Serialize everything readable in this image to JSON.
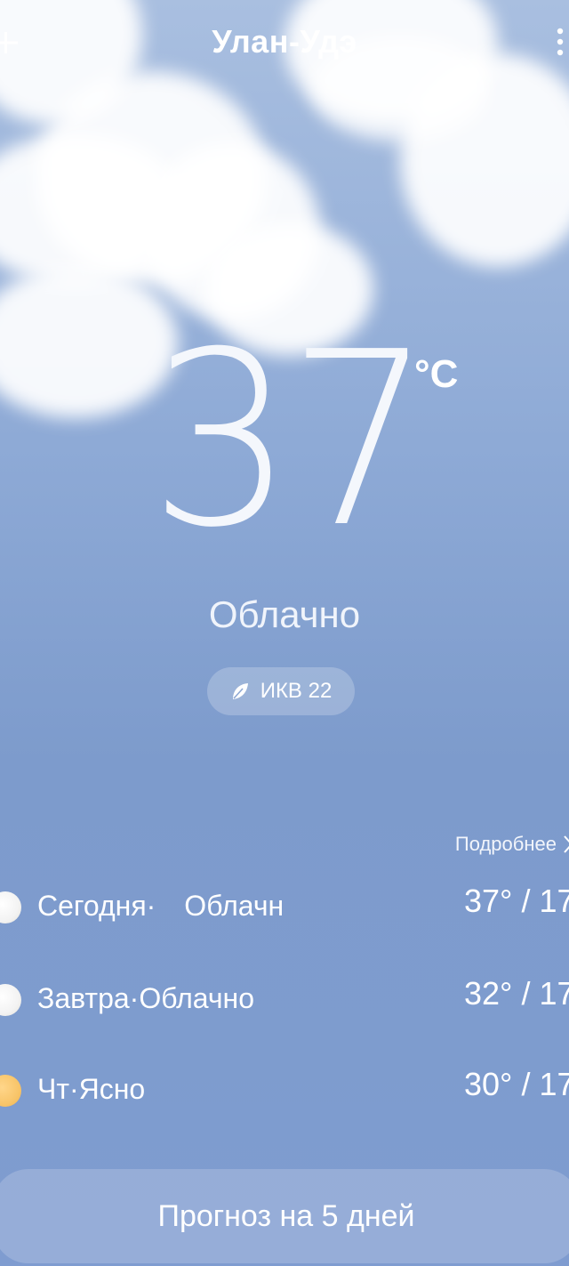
{
  "header": {
    "city": "Улан-Удэ",
    "add_icon": "plus-icon",
    "more_icon": "more-vertical-icon"
  },
  "current": {
    "temperature": "37",
    "unit": "°C",
    "condition": "Облачно",
    "aqi_label": "ИКВ 22",
    "aqi_icon": "leaf-icon"
  },
  "forecast": {
    "details_label": "Подробнее",
    "days": [
      {
        "label": "Сегодня·",
        "condition": "Облачн",
        "temps": "37° / 17",
        "icon": "cloud-sun-icon"
      },
      {
        "label": "Завтра·Облачно",
        "temps": "32° / 17",
        "icon": "cloud-sun-icon"
      },
      {
        "label": "Чт·Ясно",
        "temps": "30° / 17",
        "icon": "sun-icon"
      }
    ]
  },
  "footer": {
    "button_label": "Прогноз на 5 дней"
  },
  "colors": {
    "sky_top": "#a9bfe0",
    "sky_bottom": "#7f9cd0",
    "sun": "#f8c56a"
  }
}
